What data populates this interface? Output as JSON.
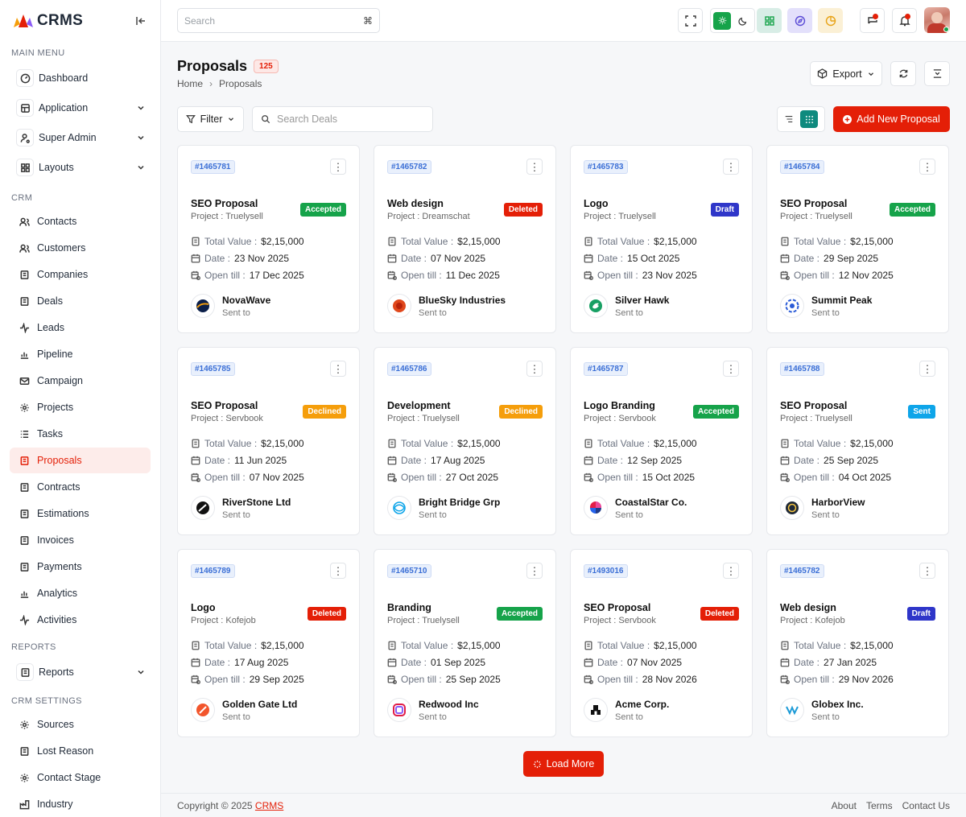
{
  "brand": {
    "name": "CRMS"
  },
  "sidebar": {
    "main_menu_title": "MAIN MENU",
    "main": [
      {
        "label": "Dashboard",
        "icon": "dashboard-icon"
      },
      {
        "label": "Application",
        "icon": "application-icon",
        "has_children": true
      },
      {
        "label": "Super Admin",
        "icon": "user-cog-icon",
        "has_children": true
      },
      {
        "label": "Layouts",
        "icon": "layouts-icon",
        "has_children": true
      }
    ],
    "crm_title": "CRM",
    "crm": [
      {
        "label": "Contacts"
      },
      {
        "label": "Customers"
      },
      {
        "label": "Companies"
      },
      {
        "label": "Deals"
      },
      {
        "label": "Leads"
      },
      {
        "label": "Pipeline"
      },
      {
        "label": "Campaign"
      },
      {
        "label": "Projects"
      },
      {
        "label": "Tasks"
      },
      {
        "label": "Proposals",
        "active": true
      },
      {
        "label": "Contracts"
      },
      {
        "label": "Estimations"
      },
      {
        "label": "Invoices"
      },
      {
        "label": "Payments"
      },
      {
        "label": "Analytics"
      },
      {
        "label": "Activities"
      }
    ],
    "reports_title": "REPORTS",
    "reports": [
      {
        "label": "Reports",
        "has_children": true
      }
    ],
    "settings_title": "CRM SETTINGS",
    "settings": [
      {
        "label": "Sources"
      },
      {
        "label": "Lost Reason"
      },
      {
        "label": "Contact Stage"
      },
      {
        "label": "Industry"
      }
    ]
  },
  "topbar": {
    "search_placeholder": "Search",
    "search_shortcut": "⌘"
  },
  "page": {
    "title": "Proposals",
    "count": "125",
    "breadcrumb": [
      "Home",
      "Proposals"
    ],
    "export_label": "Export",
    "filter_label": "Filter",
    "search_deals_placeholder": "Search Deals",
    "add_label": "Add New Proposal",
    "load_more_label": "Load More"
  },
  "colors": {
    "accent": "#e41f07",
    "accepted": "#16a34a",
    "deleted": "#e41f07",
    "draft": "#2f36c9",
    "declined": "#f59e0b",
    "sent": "#0ea5e9"
  },
  "labels": {
    "total_value": "Total Value :",
    "date": "Date :",
    "open_till": "Open till :",
    "sent_to": "Sent to",
    "project_prefix": "Project : "
  },
  "proposals": [
    {
      "id": "#1465781",
      "title": "SEO Proposal",
      "project": "Project : Truelysell",
      "status": "Accepted",
      "status_color": "#16a34a",
      "value": "$2,15,000",
      "date": "23 Nov 2025",
      "open_till": "17 Dec 2025",
      "client": "NovaWave",
      "logo": "novawave-logo"
    },
    {
      "id": "#1465782",
      "title": "Web design",
      "project": "Project : Dreamschat",
      "status": "Deleted",
      "status_color": "#e41f07",
      "value": "$2,15,000",
      "date": "07 Nov 2025",
      "open_till": "11 Dec 2025",
      "client": "BlueSky Industries",
      "logo": "bluesky-logo"
    },
    {
      "id": "#1465783",
      "title": "Logo",
      "project": "Project : Truelysell",
      "status": "Draft",
      "status_color": "#2f36c9",
      "value": "$2,15,000",
      "date": "15 Oct 2025",
      "open_till": "23 Nov 2025",
      "client": "Silver Hawk",
      "logo": "silverhawk-logo"
    },
    {
      "id": "#1465784",
      "title": "SEO Proposal",
      "project": "Project : Truelysell",
      "status": "Accepted",
      "status_color": "#16a34a",
      "value": "$2,15,000",
      "date": "29 Sep 2025",
      "open_till": "12 Nov 2025",
      "client": "Summit  Peak",
      "logo": "summitpeak-logo"
    },
    {
      "id": "#1465785",
      "title": "SEO Proposal",
      "project": "Project : Servbook",
      "status": "Declined",
      "status_color": "#f59e0b",
      "value": "$2,15,000",
      "date": "11 Jun 2025",
      "open_till": "07 Nov 2025",
      "client": "RiverStone Ltd",
      "logo": "riverstone-logo"
    },
    {
      "id": "#1465786",
      "title": "Development",
      "project": "Project : Truelysell",
      "status": "Declined",
      "status_color": "#f59e0b",
      "value": "$2,15,000",
      "date": "17 Aug 2025",
      "open_till": "27 Oct 2025",
      "client": "Bright Bridge Grp",
      "logo": "brightbridge-logo"
    },
    {
      "id": "#1465787",
      "title": "Logo Branding",
      "project": "Project : Servbook",
      "status": "Accepted",
      "status_color": "#16a34a",
      "value": "$2,15,000",
      "date": "12 Sep 2025",
      "open_till": "15 Oct 2025",
      "client": "CoastalStar Co.",
      "logo": "coastalstar-logo"
    },
    {
      "id": "#1465788",
      "title": "SEO Proposal",
      "project": "Project : Truelysell",
      "status": "Sent",
      "status_color": "#0ea5e9",
      "value": "$2,15,000",
      "date": "25 Sep 2025",
      "open_till": "04 Oct 2025",
      "client": "HarborView",
      "logo": "harborview-logo"
    },
    {
      "id": "#1465789",
      "title": "Logo",
      "project": "Project : Kofejob",
      "status": "Deleted",
      "status_color": "#e41f07",
      "value": "$2,15,000",
      "date": "17 Aug 2025",
      "open_till": "29 Sep 2025",
      "client": "Golden Gate Ltd",
      "logo": "goldengate-logo"
    },
    {
      "id": "#1465710",
      "title": "Branding",
      "project": "Project : Truelysell",
      "status": "Accepted",
      "status_color": "#16a34a",
      "value": "$2,15,000",
      "date": "01 Sep 2025",
      "open_till": "25 Sep 2025",
      "client": "Redwood Inc",
      "logo": "redwood-logo"
    },
    {
      "id": "#1493016",
      "title": "SEO Proposal",
      "project": "Project : Servbook",
      "status": "Deleted",
      "status_color": "#e41f07",
      "value": "$2,15,000",
      "date": "07 Nov 2025",
      "open_till": "28 Nov 2026",
      "client": "Acme Corp.",
      "logo": "acme-logo"
    },
    {
      "id": "#1465782",
      "title": "Web design",
      "project": "Project : Kofejob",
      "status": "Draft",
      "status_color": "#2f36c9",
      "value": "$2,15,000",
      "date": "27 Jan 2025",
      "open_till": "29 Nov 2026",
      "client": "Globex Inc.",
      "logo": "globex-logo"
    }
  ],
  "footer": {
    "copyright": "Copyright © 2025",
    "brand_link": "CRMS",
    "links": [
      "About",
      "Terms",
      "Contact Us"
    ]
  }
}
